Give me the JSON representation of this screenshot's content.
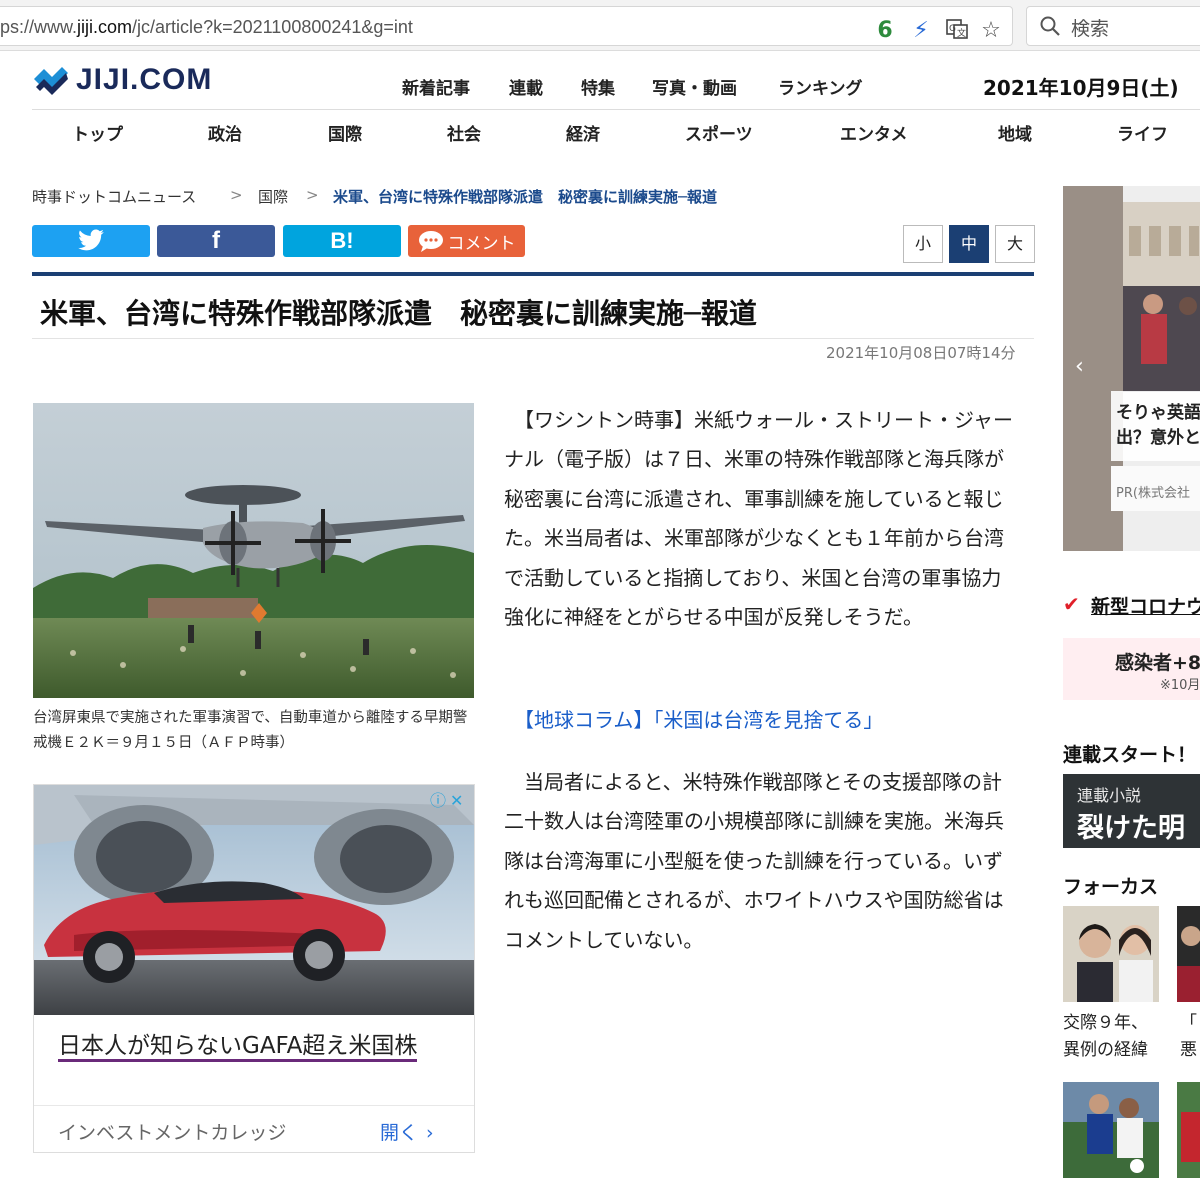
{
  "browser": {
    "url_prefix": "ps://www.",
    "url_domain": "jiji.com",
    "url_path": "/jc/article?k=2021100800241&g=int",
    "badge": "6",
    "search_placeholder": "検索"
  },
  "header": {
    "logo_text": "JIJI.COM",
    "top_nav": [
      "新着記事",
      "連載",
      "特集",
      "写真・動画",
      "ランキング"
    ],
    "date": "2021年10月9日(土)",
    "categories": [
      "トップ",
      "政治",
      "国際",
      "社会",
      "経済",
      "スポーツ",
      "エンタメ",
      "地域",
      "ライフ"
    ]
  },
  "breadcrumb": {
    "home": "時事ドットコムニュース",
    "section": "国際",
    "current": "米軍、台湾に特殊作戦部隊派遣　秘密裏に訓練実施─報道",
    "separator": ">"
  },
  "share": {
    "hatena": "B!",
    "comment": "コメント"
  },
  "font_size": {
    "small": "小",
    "medium": "中",
    "large": "大"
  },
  "article": {
    "title": "米軍、台湾に特殊作戦部隊派遣　秘密裏に訓練実施─報道",
    "timestamp": "2021年10月08日07時14分",
    "photo_caption": "台湾屏東県で実施された軍事演習で、自動車道から離陸する早期警戒機Ｅ２Ｋ＝９月１５日（ＡＦＰ時事）",
    "paragraph1": "　【ワシントン時事】米紙ウォール・ストリート・ジャーナル（電子版）は７日、米軍の特殊作戦部隊と海兵隊が秘密裏に台湾に派遣され、軍事訓練を施していると報じた。米当局者は、米軍部隊が少なくとも１年前から台湾で活動していると指摘しており、米国と台湾の軍事協力強化に神経をとがらせる中国が反発しそうだ。",
    "column_link": "【地球コラム】「米国は台湾を見捨てる」",
    "paragraph2": "　当局者によると、米特殊作戦部隊とその支援部隊の計二十数人は台湾陸軍の小規模部隊に訓練を実施。米海兵隊は台湾海軍に小型艇を使った訓練を行っている。いずれも巡回配備とされるが、ホワイトハウスや国防総省はコメントしていない。"
  },
  "ad": {
    "title": "日本人が知らないGAFA超え米国株",
    "advertiser": "インベストメントカレッジ",
    "open_label": "開く"
  },
  "sidebar": {
    "banner_text": "そりゃ英語\n出？意外と",
    "banner_pr": "PR(株式会社",
    "covid_heading": "新型コロナウ",
    "covid_infected": "感染者+8",
    "covid_note": "※10月",
    "serial_heading": "連載スタート！",
    "serial_banner_small": "連載小説",
    "serial_banner_big": "裂けた明",
    "focus_heading": "フォーカス",
    "focus1_caption": "交際９年、\n異例の経緯",
    "focus2_caption": "「\n悪"
  },
  "colors": {
    "navy": "#1b3f73",
    "twitter": "#1da1f2",
    "facebook": "#3b5998",
    "hatena": "#00a4de",
    "comment": "#e8623a",
    "link": "#1a5ec9"
  }
}
